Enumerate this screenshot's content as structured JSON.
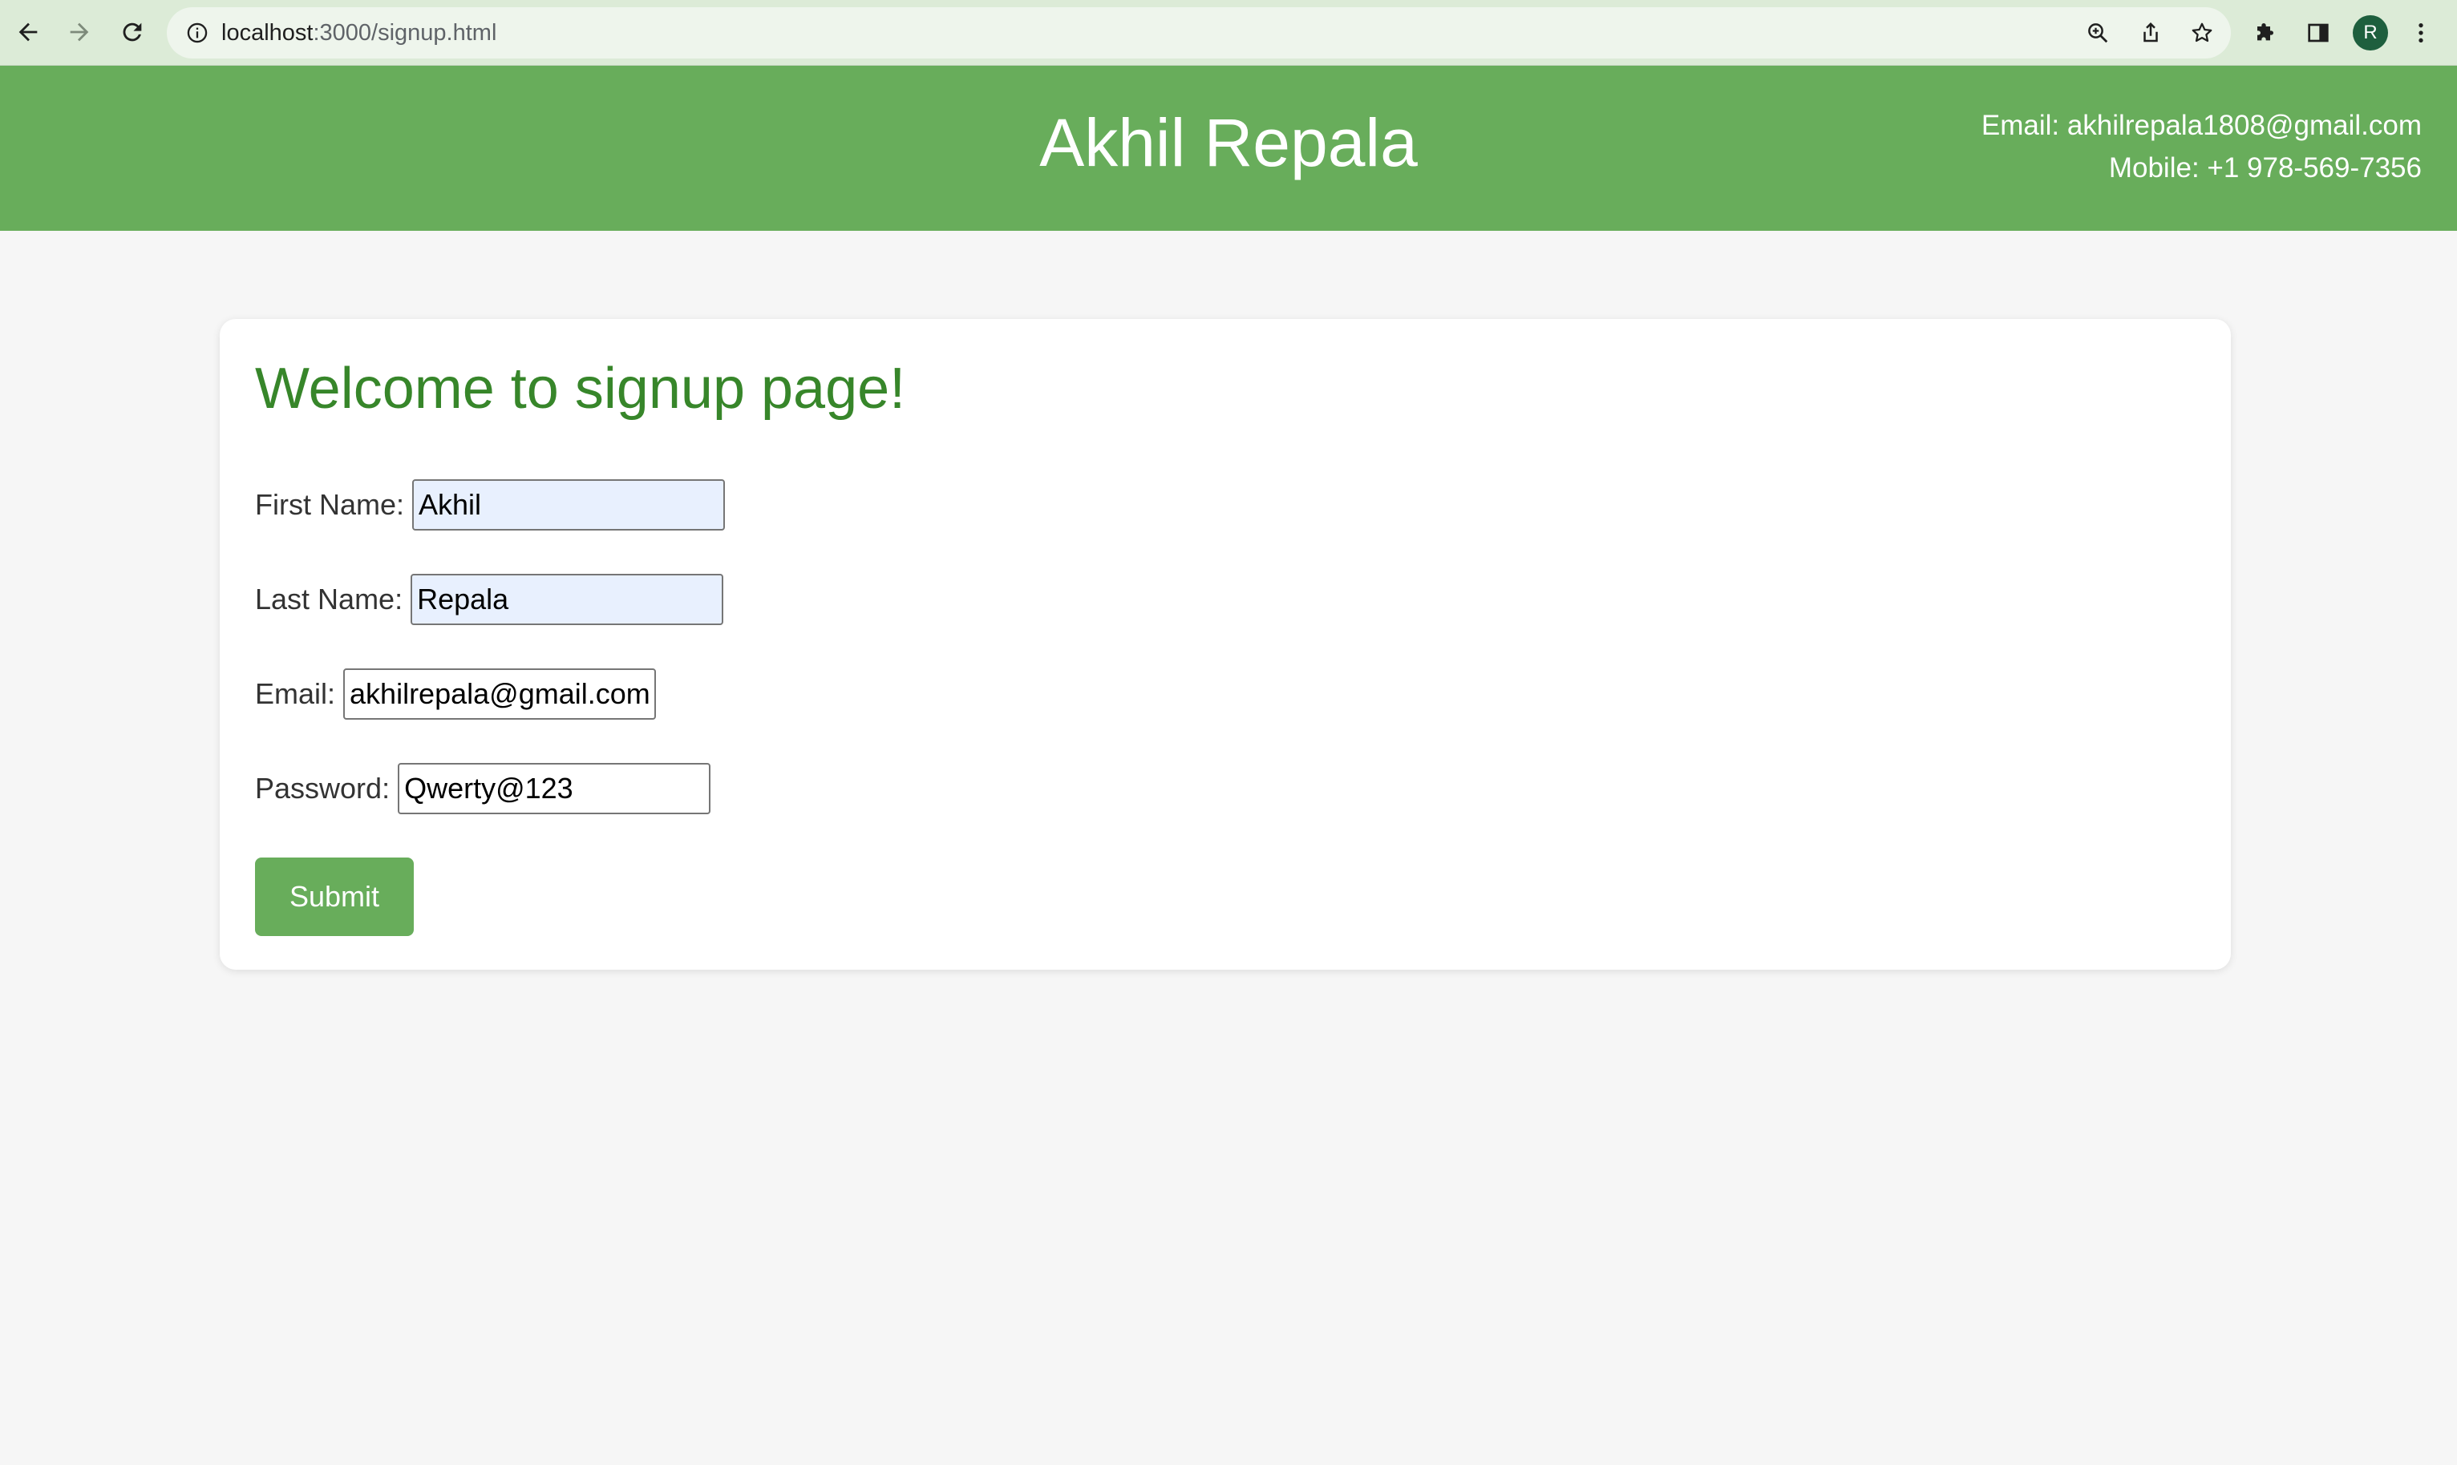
{
  "browser": {
    "url_host": "localhost",
    "url_path": ":3000/signup.html",
    "profile_initial": "R",
    "icons": [
      "back-arrow-icon",
      "forward-arrow-icon",
      "reload-icon",
      "info-icon",
      "zoom-icon",
      "share-icon",
      "star-icon",
      "extensions-puzzle-icon",
      "side-panel-icon",
      "more-vert-icon"
    ]
  },
  "header": {
    "title": "Akhil Repala",
    "email_line": "Email: akhilrepala1808@gmail.com",
    "mobile_line": "Mobile: +1 978-569-7356"
  },
  "form": {
    "heading": "Welcome to signup page!",
    "first_name": {
      "label": "First Name:",
      "value": "Akhil"
    },
    "last_name": {
      "label": "Last Name:",
      "value": "Repala"
    },
    "email": {
      "label": "Email:",
      "value": "akhilrepala@gmail.com"
    },
    "password": {
      "label": "Password:",
      "value": "Qwerty@123"
    },
    "submit_label": "Submit"
  },
  "colors": {
    "header_bg": "#68ad5b",
    "heading_text": "#37862a",
    "button_bg": "#68ad5b",
    "page_bg": "#f6f6f6",
    "autofill_bg": "#e8f0fe"
  }
}
